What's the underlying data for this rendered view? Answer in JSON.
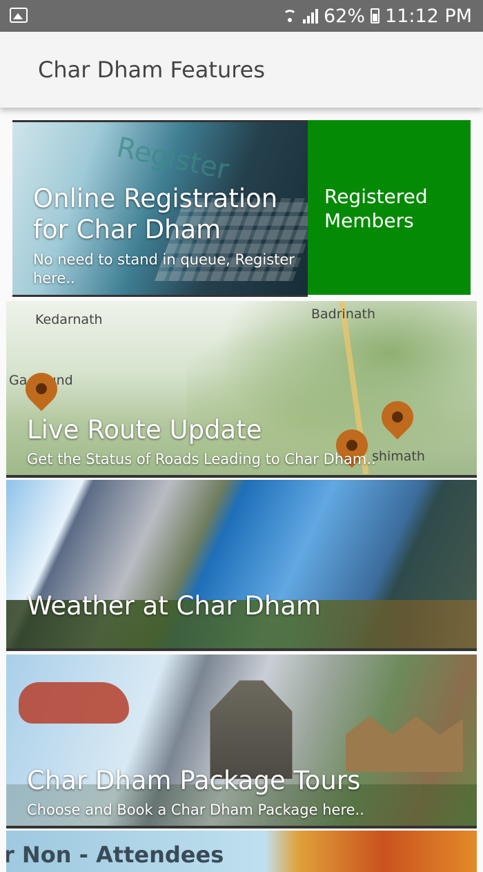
{
  "status_bar": {
    "battery_percent": "62%",
    "time": "11:12 PM",
    "icons": [
      "image-icon",
      "wifi-icon",
      "signal-icon",
      "battery-icon"
    ]
  },
  "app_bar": {
    "title": "Char Dham Features"
  },
  "cards": {
    "registration": {
      "title": "Online Registration for Char Dham",
      "subtitle": "No need to stand in queue, Register here..",
      "image_text": "Register"
    },
    "registered_members": {
      "label": "Registered Members",
      "color": "#058a05"
    },
    "route": {
      "title": "Live Route Update",
      "subtitle": "Get the Status of Roads Leading to Char Dham..",
      "map_labels": {
        "kedarnath": "Kedarnath",
        "badrinath": "Badrinath",
        "gaurikund": "Ga     und",
        "joshimath": "shimath"
      }
    },
    "weather": {
      "title": "Weather at Char Dham"
    },
    "tours": {
      "title": "Char Dham Package Tours",
      "subtitle": "Choose and Book a Char Dham Package here.."
    },
    "next": {
      "title": "r Non - Attendees"
    }
  }
}
